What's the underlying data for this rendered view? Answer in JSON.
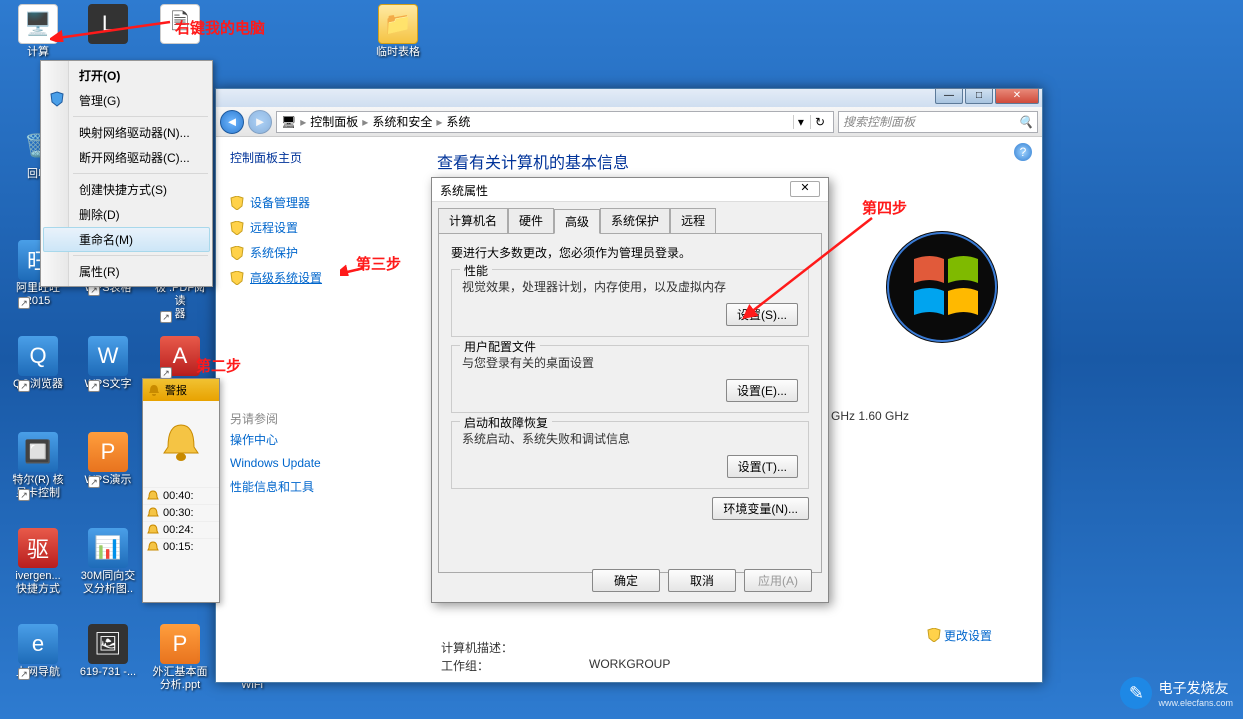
{
  "annotations": {
    "step1": "右键我的电脑",
    "step2": "第二步",
    "step3": "第三步",
    "step4": "第四步"
  },
  "desktop_icons": {
    "computer": "计算",
    "lol": "",
    "temp_folder": "临时表格",
    "recycle": "回收",
    "aliww": "阿里旺旺\n2015",
    "wps_sheet": "WPS表格",
    "pdf_reader": "极 :PDF阅读\n器",
    "qq_browser": "QQ浏览器",
    "wps_text": "WPS文字",
    "intel": "特尔(R) 核\n显卡控制",
    "wps_ppt": "WPS演示",
    "driver": "驱",
    "sync": "30M同向交\n叉分析图..",
    "ivg": "ivergen...\n快捷方式",
    "nav": "上网导航",
    "img619": "619-731 -...",
    "forex": "外汇基本面\n分析.ppt",
    "wifi": "开启免费\nWiFi"
  },
  "context_menu": {
    "open": "打开(O)",
    "manage": "管理(G)",
    "map_drive": "映射网络驱动器(N)...",
    "disconnect_drive": "断开网络驱动器(C)...",
    "shortcut": "创建快捷方式(S)",
    "delete": "删除(D)",
    "rename": "重命名(M)",
    "properties": "属性(R)"
  },
  "cp_window": {
    "btn_min": "—",
    "btn_max": "□",
    "btn_close": "✕",
    "breadcrumb": {
      "root": "控制面板",
      "l2": "系统和安全",
      "l3": "系统"
    },
    "search_ph": "搜索控制面板",
    "side_title": "控制面板主页",
    "links": {
      "devmgr": "设备管理器",
      "remote": "远程设置",
      "sysprot": "系统保护",
      "advsys": "高级系统设置"
    },
    "see_also": "另请参阅",
    "refs": {
      "action": "操作中心",
      "wu": "Windows Update",
      "perf": "性能信息和工具"
    },
    "main_title": "查看有关计算机的基本信息",
    "cpu_partial": "GHz  1.60 GHz",
    "desc_label": "计算机描述：",
    "workgroup_label": "工作组：",
    "workgroup_val": "WORKGROUP",
    "change_settings": "更改设置"
  },
  "sys_dlg": {
    "title": "系统属性",
    "tabs": {
      "name": "计算机名",
      "hw": "硬件",
      "adv": "高级",
      "prot": "系统保护",
      "remote": "远程"
    },
    "admin_note": "要进行大多数更改，您必须作为管理员登录。",
    "perf": {
      "title": "性能",
      "desc": "视觉效果，处理器计划，内存使用，以及虚拟内存",
      "btn": "设置(S)..."
    },
    "profile": {
      "title": "用户配置文件",
      "desc": "与您登录有关的桌面设置",
      "btn": "设置(E)..."
    },
    "startup": {
      "title": "启动和故障恢复",
      "desc": "系统启动、系统失败和调试信息",
      "btn": "设置(T)..."
    },
    "env_btn": "环境变量(N)...",
    "ok": "确定",
    "cancel": "取消",
    "apply": "应用(A)"
  },
  "alarm": {
    "title": "警报",
    "rows": [
      "00:40:",
      "00:30:",
      "00:24:",
      "00:15:"
    ]
  },
  "watermark": {
    "text": "电子发烧友",
    "sub": "www.elecfans.com"
  }
}
